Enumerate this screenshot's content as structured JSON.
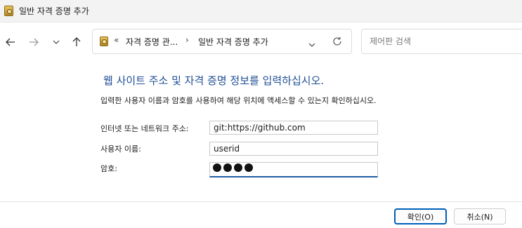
{
  "window": {
    "title": "일반 자격 증명 추가"
  },
  "nav": {
    "back_icon": "arrow-left-icon",
    "forward_icon": "arrow-right-icon",
    "recent_icon": "chevron-down-icon",
    "up_icon": "arrow-up-icon"
  },
  "address": {
    "overflow": "«",
    "crumb1": "자격 증명 관...",
    "sep": "›",
    "crumb2": "일반 자격 증명 추가"
  },
  "search": {
    "placeholder": "제어판 검색"
  },
  "form": {
    "heading": "웹 사이트 주소 및 자격 증명 정보를 입력하십시오.",
    "description": "입력한 사용자 이름과 암호를 사용하여 해당 위치에 액세스할 수 있는지 확인하십시오.",
    "address_label": "인터넷 또는 네트워크 주소:",
    "address_value": "git:https://github.com",
    "username_label": "사용자 이름:",
    "username_value": "userid",
    "password_label": "암호:",
    "password_masked_chars": 4
  },
  "buttons": {
    "ok": "확인(O)",
    "cancel": "취소(N)"
  }
}
